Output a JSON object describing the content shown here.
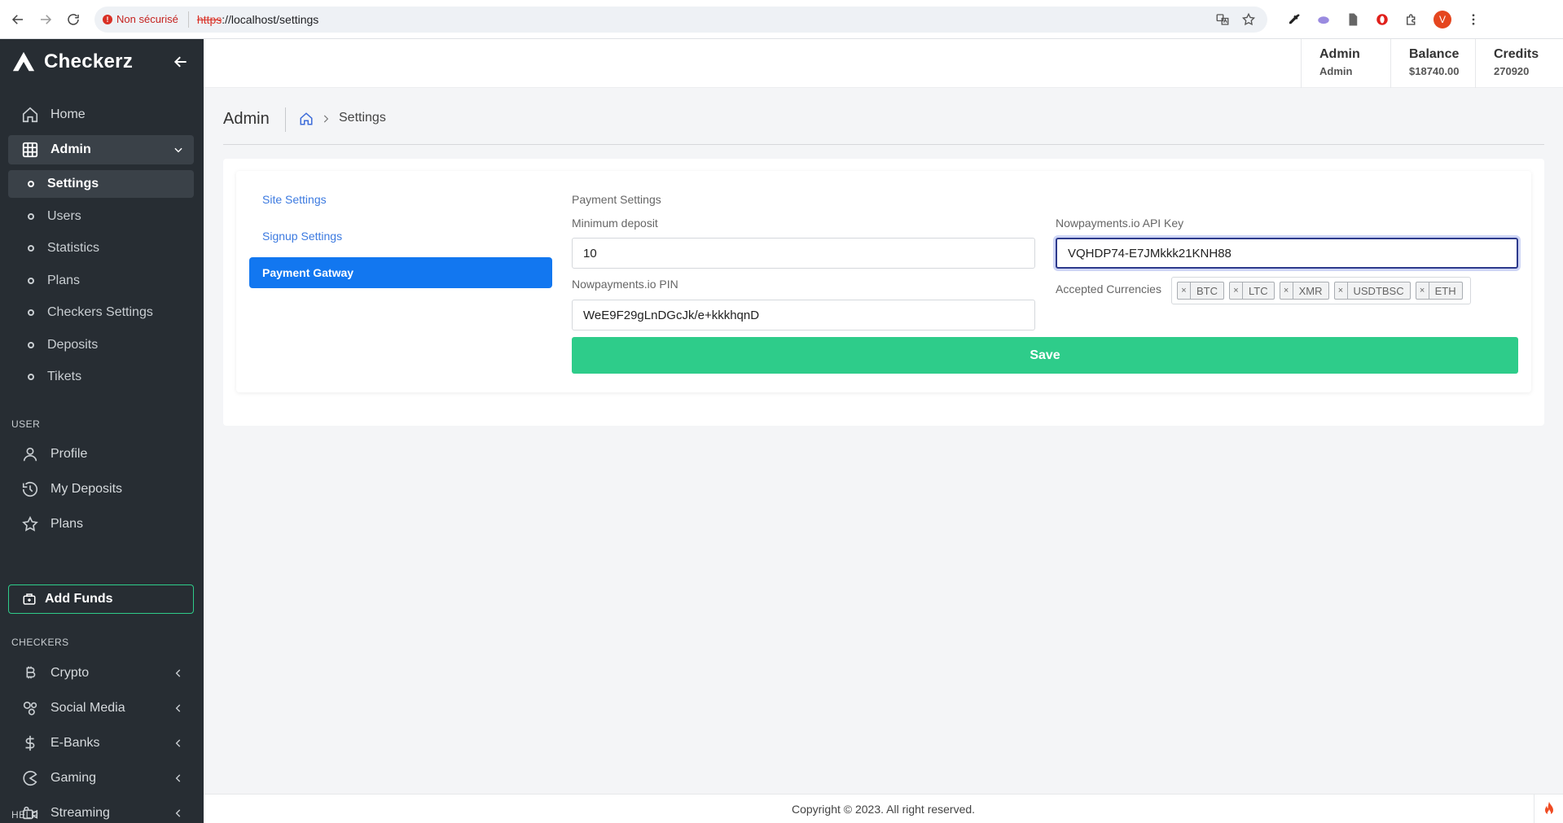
{
  "browser": {
    "security_label": "Non sécurisé",
    "url_scheme": "https",
    "url_rest": "://localhost/settings",
    "profile_initial": "V"
  },
  "brand": {
    "name": "Checkerz"
  },
  "sidebar": {
    "home": "Home",
    "admin": "Admin",
    "admin_items": [
      "Settings",
      "Users",
      "Statistics",
      "Plans",
      "Checkers Settings",
      "Deposits",
      "Tikets"
    ],
    "user_section": "USER",
    "user_items": [
      "Profile",
      "My Deposits",
      "Plans"
    ],
    "add_funds": "Add Funds",
    "checkers_section": "CHECKERS",
    "checkers_items": [
      "Crypto",
      "Social Media",
      "E-Banks",
      "Gaming",
      "Streaming"
    ],
    "help_section": "HELP"
  },
  "topbar": {
    "user": {
      "label": "Admin",
      "value": "Admin"
    },
    "balance": {
      "label": "Balance",
      "value": "$18740.00"
    },
    "credits": {
      "label": "Credits",
      "value": "270920"
    }
  },
  "page": {
    "title": "Admin",
    "breadcrumb_current": "Settings"
  },
  "settings": {
    "tabs": [
      "Site Settings",
      "Signup Settings",
      "Payment Gatway"
    ],
    "active_tab_index": 2,
    "section_title": "Payment Settings",
    "min_deposit_label": "Minimum deposit",
    "min_deposit_value": "10",
    "pin_label": "Nowpayments.io PIN",
    "pin_value": "WeE9F29gLnDGcJk/e+kkkhqnD",
    "api_key_label": "Nowpayments.io API Key",
    "api_key_value": "VQHDP74-E7JMkkk21KNH88",
    "currencies_label": "Accepted Currencies",
    "currencies": [
      "BTC",
      "LTC",
      "XMR",
      "USDTBSC",
      "ETH"
    ],
    "save_label": "Save"
  },
  "footer": {
    "copyright": "Copyright © 2023. All right reserved."
  }
}
